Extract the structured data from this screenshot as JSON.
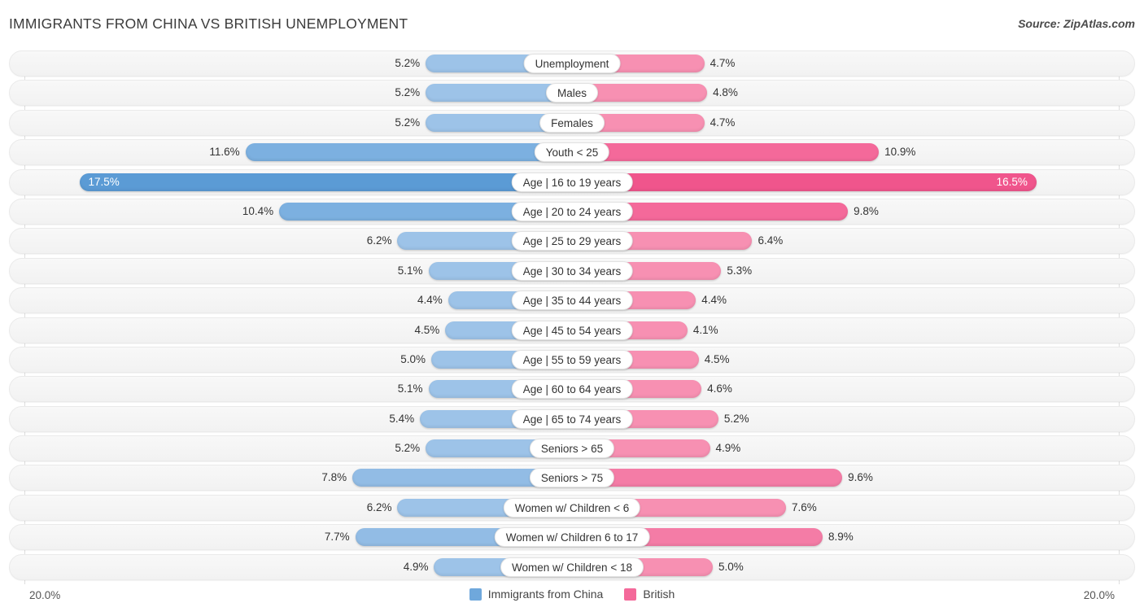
{
  "header": {
    "title": "IMMIGRANTS FROM CHINA VS BRITISH UNEMPLOYMENT",
    "source": "Source: ZipAtlas.com"
  },
  "axis": {
    "left_max_label": "20.0%",
    "right_max_label": "20.0%",
    "max_value": 20.0
  },
  "legend": {
    "items": [
      {
        "label": "Immigrants from China",
        "color": "#6fa8dc"
      },
      {
        "label": "British",
        "color": "#f4699a"
      }
    ]
  },
  "colors": {
    "left_normal": "#9dc3e8",
    "left_strong": "#6fa8dc",
    "left_max": "#5b9bd5",
    "right_normal": "#f790b2",
    "right_strong": "#f4699a",
    "right_max": "#f0558c",
    "track": "#f4f4f4",
    "gridline": "#dedede"
  },
  "chart_data": {
    "type": "bar",
    "title": "IMMIGRANTS FROM CHINA VS BRITISH UNEMPLOYMENT",
    "subtitle": "",
    "xlabel": "",
    "ylabel": "",
    "orientation": "horizontal-diverging",
    "xlim": [
      20.0,
      20.0
    ],
    "grid": true,
    "legend_position": "bottom-center",
    "categories": [
      "Unemployment",
      "Males",
      "Females",
      "Youth < 25",
      "Age | 16 to 19 years",
      "Age | 20 to 24 years",
      "Age | 25 to 29 years",
      "Age | 30 to 34 years",
      "Age | 35 to 44 years",
      "Age | 45 to 54 years",
      "Age | 55 to 59 years",
      "Age | 60 to 64 years",
      "Age | 65 to 74 years",
      "Seniors > 65",
      "Seniors > 75",
      "Women w/ Children < 6",
      "Women w/ Children 6 to 17",
      "Women w/ Children < 18"
    ],
    "series": [
      {
        "name": "Immigrants from China",
        "color": "#6fa8dc",
        "values": [
          5.2,
          5.2,
          5.2,
          11.6,
          17.5,
          10.4,
          6.2,
          5.1,
          4.4,
          4.5,
          5.0,
          5.1,
          5.4,
          5.2,
          7.8,
          6.2,
          7.7,
          4.9
        ]
      },
      {
        "name": "British",
        "color": "#f4699a",
        "values": [
          4.7,
          4.8,
          4.7,
          10.9,
          16.5,
          9.8,
          6.4,
          5.3,
          4.4,
          4.1,
          4.5,
          4.6,
          5.2,
          4.9,
          9.6,
          7.6,
          8.9,
          5.0
        ]
      }
    ]
  },
  "rows": [
    {
      "label": "Unemployment",
      "left": "5.2%",
      "right": "4.7%",
      "lv": 5.2,
      "rv": 4.7,
      "lc": "#9dc3e8",
      "rc": "#f790b2",
      "l_in": false,
      "r_in": false
    },
    {
      "label": "Males",
      "left": "5.2%",
      "right": "4.8%",
      "lv": 5.2,
      "rv": 4.8,
      "lc": "#9dc3e8",
      "rc": "#f790b2",
      "l_in": false,
      "r_in": false
    },
    {
      "label": "Females",
      "left": "5.2%",
      "right": "4.7%",
      "lv": 5.2,
      "rv": 4.7,
      "lc": "#9dc3e8",
      "rc": "#f790b2",
      "l_in": false,
      "r_in": false
    },
    {
      "label": "Youth < 25",
      "left": "11.6%",
      "right": "10.9%",
      "lv": 11.6,
      "rv": 10.9,
      "lc": "#7cb0e0",
      "rc": "#f4699a",
      "l_in": false,
      "r_in": false
    },
    {
      "label": "Age | 16 to 19 years",
      "left": "17.5%",
      "right": "16.5%",
      "lv": 17.5,
      "rv": 16.5,
      "lc": "#5b9bd5",
      "rc": "#f0558c",
      "l_in": true,
      "r_in": true
    },
    {
      "label": "Age | 20 to 24 years",
      "left": "10.4%",
      "right": "9.8%",
      "lv": 10.4,
      "rv": 9.8,
      "lc": "#7cb0e0",
      "rc": "#f4699a",
      "l_in": false,
      "r_in": false
    },
    {
      "label": "Age | 25 to 29 years",
      "left": "6.2%",
      "right": "6.4%",
      "lv": 6.2,
      "rv": 6.4,
      "lc": "#9dc3e8",
      "rc": "#f790b2",
      "l_in": false,
      "r_in": false
    },
    {
      "label": "Age | 30 to 34 years",
      "left": "5.1%",
      "right": "5.3%",
      "lv": 5.1,
      "rv": 5.3,
      "lc": "#9dc3e8",
      "rc": "#f790b2",
      "l_in": false,
      "r_in": false
    },
    {
      "label": "Age | 35 to 44 years",
      "left": "4.4%",
      "right": "4.4%",
      "lv": 4.4,
      "rv": 4.4,
      "lc": "#9dc3e8",
      "rc": "#f790b2",
      "l_in": false,
      "r_in": false
    },
    {
      "label": "Age | 45 to 54 years",
      "left": "4.5%",
      "right": "4.1%",
      "lv": 4.5,
      "rv": 4.1,
      "lc": "#9dc3e8",
      "rc": "#f790b2",
      "l_in": false,
      "r_in": false
    },
    {
      "label": "Age | 55 to 59 years",
      "left": "5.0%",
      "right": "4.5%",
      "lv": 5.0,
      "rv": 4.5,
      "lc": "#9dc3e8",
      "rc": "#f790b2",
      "l_in": false,
      "r_in": false
    },
    {
      "label": "Age | 60 to 64 years",
      "left": "5.1%",
      "right": "4.6%",
      "lv": 5.1,
      "rv": 4.6,
      "lc": "#9dc3e8",
      "rc": "#f790b2",
      "l_in": false,
      "r_in": false
    },
    {
      "label": "Age | 65 to 74 years",
      "left": "5.4%",
      "right": "5.2%",
      "lv": 5.4,
      "rv": 5.2,
      "lc": "#9dc3e8",
      "rc": "#f790b2",
      "l_in": false,
      "r_in": false
    },
    {
      "label": "Seniors > 65",
      "left": "5.2%",
      "right": "4.9%",
      "lv": 5.2,
      "rv": 4.9,
      "lc": "#9dc3e8",
      "rc": "#f790b2",
      "l_in": false,
      "r_in": false
    },
    {
      "label": "Seniors > 75",
      "left": "7.8%",
      "right": "9.6%",
      "lv": 7.8,
      "rv": 9.6,
      "lc": "#92bce5",
      "rc": "#f47ca6",
      "l_in": false,
      "r_in": false
    },
    {
      "label": "Women w/ Children < 6",
      "left": "6.2%",
      "right": "7.6%",
      "lv": 6.2,
      "rv": 7.6,
      "lc": "#9dc3e8",
      "rc": "#f790b2",
      "l_in": false,
      "r_in": false
    },
    {
      "label": "Women w/ Children 6 to 17",
      "left": "7.7%",
      "right": "8.9%",
      "lv": 7.7,
      "rv": 8.9,
      "lc": "#92bce5",
      "rc": "#f47ca6",
      "l_in": false,
      "r_in": false
    },
    {
      "label": "Women w/ Children < 18",
      "left": "4.9%",
      "right": "5.0%",
      "lv": 4.9,
      "rv": 5.0,
      "lc": "#9dc3e8",
      "rc": "#f790b2",
      "l_in": false,
      "r_in": false
    }
  ]
}
